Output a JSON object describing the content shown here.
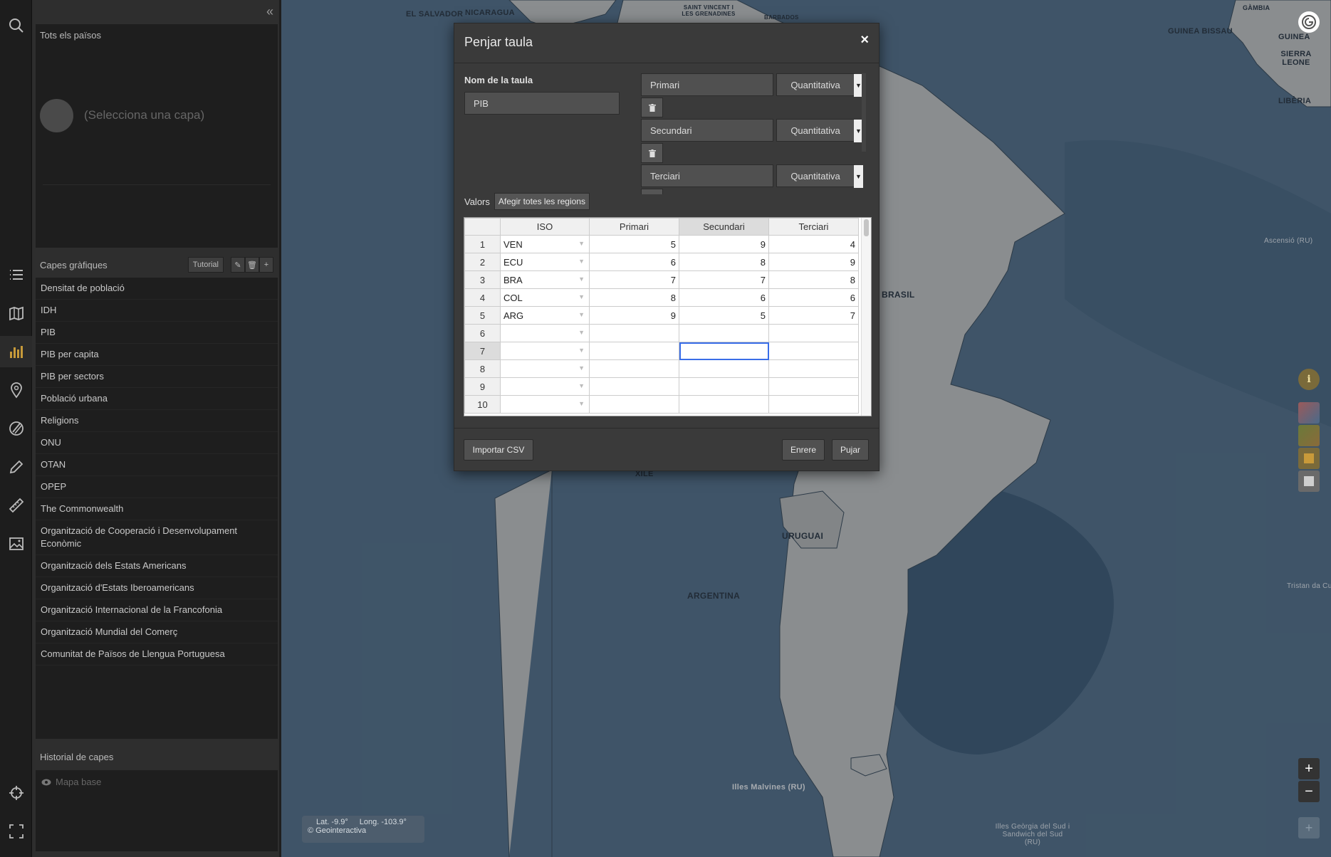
{
  "sidebar": {
    "countries_header": "Tots els països",
    "select_layer": "(Selecciona una capa)",
    "graphic_layers_title": "Capes gràfiques",
    "tutorial_label": "Tutorial",
    "layers": [
      "Densitat de població",
      "IDH",
      "PIB",
      "PIB per capita",
      "PIB per sectors",
      "Població urbana",
      "Religions",
      "ONU",
      "OTAN",
      "OPEP",
      "The Commonwealth",
      "Organització de Cooperació i Desenvolupament Econòmic",
      "Organització dels Estats Americans",
      "Organització d'Estats Iberoamericans",
      "Organització Internacional de la Francofonia",
      "Organització Mundial del Comerç",
      "Comunitat de Països de Llengua Portuguesa"
    ],
    "history_title": "Historial de capes",
    "history_items": [
      "Mapa base"
    ]
  },
  "toolbar": {
    "icons": [
      "search-icon",
      "list-icon",
      "map-book-icon",
      "bar-chart-icon",
      "location-pin-icon",
      "draw-icon",
      "pencil-icon",
      "ruler-icon",
      "image-icon",
      "crosshair-icon",
      "fullscreen-icon"
    ]
  },
  "map": {
    "labels": [
      "EL SALVADOR",
      "NICARAGUA",
      "SAINT VINCENT I LES GRENADINES",
      "BARBADOS",
      "GÀMBIA",
      "GUINEA BISSAU",
      "GUINEA",
      "SIERRA LEONE",
      "LIBÈRIA",
      "BRASIL",
      "XILE",
      "URUGUAI",
      "ARGENTINA",
      "Illes Malvines (RU)",
      "Ascensió (RU)",
      "Tristan da Cu",
      "Illes Geòrgia del Sud i Sandwich del Sud (RU)"
    ],
    "coords": {
      "lat": "Lat. -9.9°",
      "long": "Long. -103.9°",
      "copyright": "© Geointeractiva"
    }
  },
  "modal": {
    "title": "Penjar taula",
    "close": "×",
    "name_label": "Nom de la taula",
    "name_value": "PIB",
    "columns": [
      {
        "name": "Primari",
        "type": "Quantitativa"
      },
      {
        "name": "Secundari",
        "type": "Quantitativa"
      },
      {
        "name": "Terciari",
        "type": "Quantitativa"
      }
    ],
    "values_label": "Valors",
    "add_regions": "Afegir totes les regions",
    "grid": {
      "headers": [
        "ISO",
        "Primari",
        "Secundari",
        "Terciari"
      ],
      "rows": [
        [
          "VEN",
          "5",
          "9",
          "4"
        ],
        [
          "ECU",
          "6",
          "8",
          "9"
        ],
        [
          "BRA",
          "7",
          "7",
          "8"
        ],
        [
          "COL",
          "8",
          "6",
          "6"
        ],
        [
          "ARG",
          "9",
          "5",
          "7"
        ],
        [
          "",
          "",
          "",
          ""
        ],
        [
          "",
          "",
          "",
          ""
        ],
        [
          "",
          "",
          "",
          ""
        ],
        [
          "",
          "",
          "",
          ""
        ],
        [
          "",
          "",
          "",
          ""
        ]
      ],
      "row_numbers": [
        "1",
        "2",
        "3",
        "4",
        "5",
        "6",
        "7",
        "8",
        "9",
        "10"
      ]
    },
    "import_csv": "Importar CSV",
    "back": "Enrere",
    "upload": "Pujar"
  }
}
